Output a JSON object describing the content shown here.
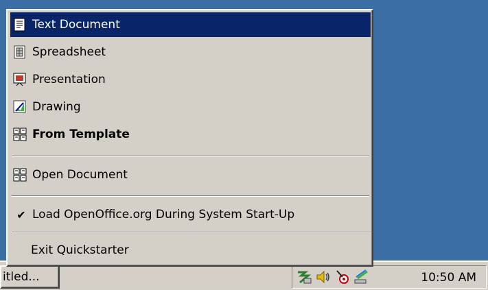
{
  "menu": {
    "items": [
      {
        "label": "Text Document",
        "icon": "text-document-icon",
        "highlighted": true,
        "bold": false
      },
      {
        "label": "Spreadsheet",
        "icon": "spreadsheet-icon",
        "highlighted": false,
        "bold": false
      },
      {
        "label": "Presentation",
        "icon": "presentation-icon",
        "highlighted": false,
        "bold": false
      },
      {
        "label": "Drawing",
        "icon": "drawing-icon",
        "highlighted": false,
        "bold": false
      },
      {
        "label": "From Template",
        "icon": "template-icon",
        "highlighted": false,
        "bold": true
      }
    ],
    "open_document": {
      "label": "Open Document",
      "icon": "open-document-icon"
    },
    "load_at_startup": {
      "label": "Load OpenOffice.org During System Start-Up",
      "checked": true,
      "check_glyph": "✔"
    },
    "exit": {
      "label": "Exit Quickstarter"
    }
  },
  "taskbar": {
    "task_button_label": "itled...",
    "tray_icons": [
      "network-icon",
      "volume-icon",
      "satellite-icon",
      "modem-icon"
    ],
    "clock": "10:50 AM"
  },
  "colors": {
    "desktop": "#3a6ea5",
    "highlight": "#0a246a",
    "face": "#d4d0c8"
  }
}
